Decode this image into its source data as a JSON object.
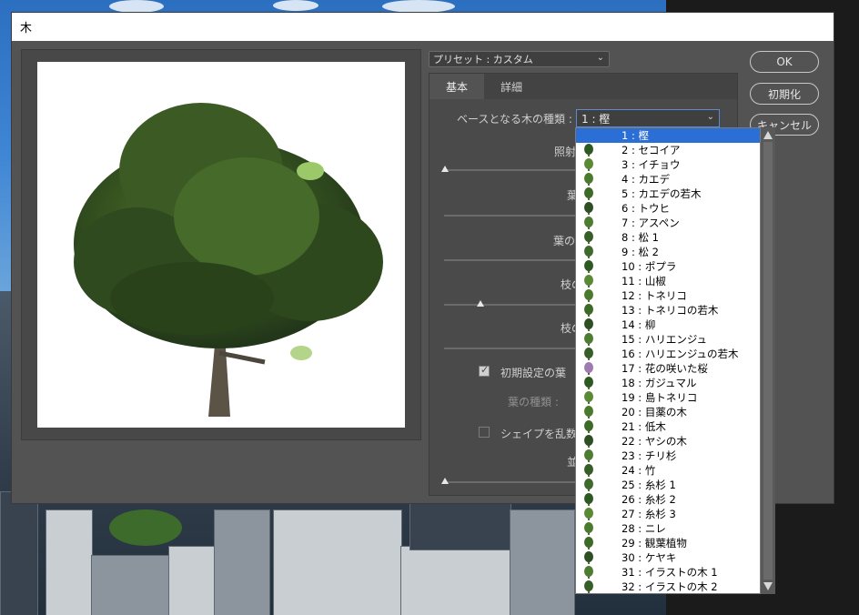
{
  "window": {
    "title": "木"
  },
  "preset": {
    "label": "プリセット : カスタム"
  },
  "tabs": [
    {
      "label": "基本"
    },
    {
      "label": "詳細"
    }
  ],
  "basic": {
    "tree_type_label": "ベースとなる木の種類 :",
    "tree_type_value": "1 : 樫",
    "light_label": "照射",
    "leaves_label": "葉",
    "leaf_label": "葉の",
    "branch1_label": "枝の",
    "branch2_label": "枝の",
    "default_leaves_label": "初期設定の葉",
    "leaf_type_label": "葉の種類 :",
    "randomize_label": "シェイプを乱数的に",
    "arrange_label": "並"
  },
  "buttons": {
    "ok": "OK",
    "reset": "初期化",
    "cancel": "キャンセル"
  },
  "dropdown_items": [
    "1 : 樫",
    "2 : セコイア",
    "3 : イチョウ",
    "4 : カエデ",
    "5 : カエデの若木",
    "6 : トウヒ",
    "7 : アスペン",
    "8 : 松 1",
    "9 : 松 2",
    "10 : ポプラ",
    "11 : 山椒",
    "12 : トネリコ",
    "13 : トネリコの若木",
    "14 : 柳",
    "15 : ハリエンジュ",
    "16 : ハリエンジュの若木",
    "17 : 花の咲いた桜",
    "18 : ガジュマル",
    "19 : 島トネリコ",
    "20 : 目薬の木",
    "21 : 低木",
    "22 : ヤシの木",
    "23 : チリ杉",
    "24 : 竹",
    "25 : 糸杉 1",
    "26 : 糸杉 2",
    "27 : 糸杉 3",
    "28 : ニレ",
    "29 : 観葉植物",
    "30 : ケヤキ",
    "31 : イラストの木 1",
    "32 : イラストの木 2"
  ],
  "colors": {
    "dialog_bg": "#535353",
    "selection": "#2a6ed6",
    "titlebar": "#ffffff"
  },
  "state": {
    "default_leaves_checked": true,
    "randomize_checked": false,
    "selected_index": 0
  }
}
